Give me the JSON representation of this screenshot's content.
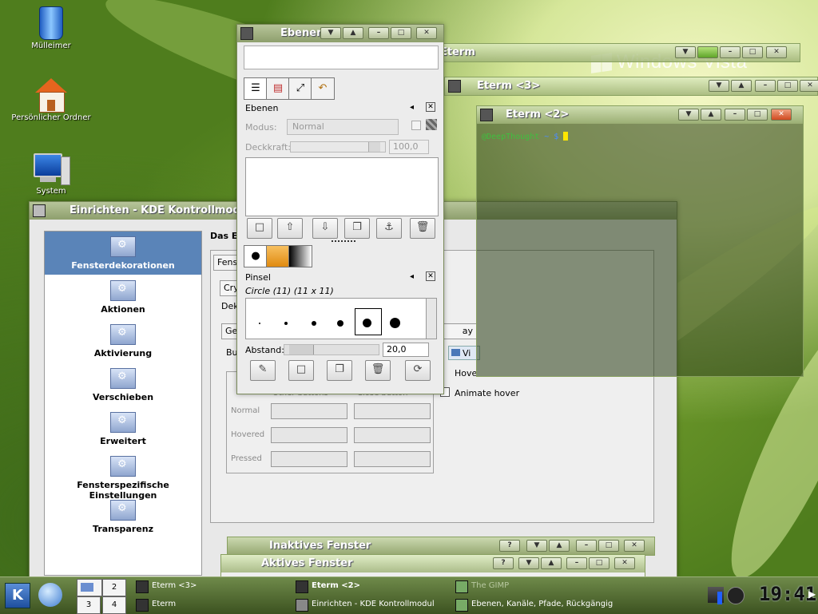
{
  "desktop": {
    "icons": [
      {
        "label": "Mülleimer",
        "icon": "trash-icon"
      },
      {
        "label": "Persönlicher Ordner",
        "icon": "home-folder-icon"
      },
      {
        "label": "System",
        "icon": "computer-icon"
      }
    ],
    "wallpaper_text": "Windows Vista"
  },
  "kde_window": {
    "title": "Einrichten - KDE Kontrollmodul",
    "sidebar": [
      {
        "label": "Fensterdekorationen",
        "selected": true
      },
      {
        "label": "Aktionen"
      },
      {
        "label": "Aktivierung"
      },
      {
        "label": "Verschieben"
      },
      {
        "label": "Erweitert"
      },
      {
        "label": "Fensterspezifische Einstellungen"
      },
      {
        "label": "Transparenz"
      }
    ],
    "header_partial": "Das Er",
    "tab_partial": "Fens",
    "combo_partial": "Cry",
    "deko_partial": "Dek",
    "subtab_partial": "Ge",
    "subtab2_partial": "ay",
    "group_partial": "Bu",
    "col_headers": [
      "Other buttons",
      "Close button"
    ],
    "rows": [
      "Normal",
      "Hovered",
      "Pressed"
    ],
    "hover_label_partial": "Hove",
    "checkbox_partial": "Vi",
    "animate_hover": "Animate hover"
  },
  "gimp_dock": {
    "title": "Ebenen",
    "layers_panel": {
      "title": "Ebenen",
      "mode_label": "Modus:",
      "mode_value": "Normal",
      "opacity_label": "Deckkraft:",
      "opacity_value": "100,0"
    },
    "brushes_panel": {
      "title": "Pinsel",
      "brush_name": "Circle (11) (11 x 11)",
      "spacing_label": "Abstand:",
      "spacing_value": "20,0"
    }
  },
  "eterm_windows": [
    {
      "title": "Eterm"
    },
    {
      "title": "Eterm <3>"
    },
    {
      "title": "Eterm <2>",
      "prompt_host": "@DeepThought",
      "prompt_rest": " ~ $ "
    }
  ],
  "preview_windows": [
    {
      "title": "Inaktives Fenster"
    },
    {
      "title": "Aktives Fenster"
    }
  ],
  "taskbar": {
    "pager": [
      "2",
      "3",
      "4"
    ],
    "tasks": [
      {
        "label": "Eterm <3>"
      },
      {
        "label": "Eterm"
      },
      {
        "label": "Eterm <2>",
        "active": true
      },
      {
        "label": "Einrichten - KDE Kontrollmodul"
      },
      {
        "label": "The GIMP",
        "dim": true
      },
      {
        "label": "Ebenen, Kanäle, Pfade, Rückgängig"
      }
    ],
    "clock": "19:41"
  }
}
